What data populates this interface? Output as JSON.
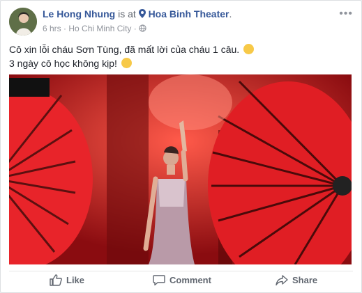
{
  "post": {
    "author": "Le Hong Nhung",
    "is_at": "is at",
    "location": "Hoa Binh Theater",
    "location_suffix": ".",
    "time": "6 hrs",
    "separator": "·",
    "city": "Ho Chi Minh City",
    "separator2": "·",
    "text_line1": "Cô xin lỗi cháu Sơn Tùng, đã mất lời của cháu 1 câu.",
    "text_line2": "3 ngày cô học không kịp!",
    "icons": {
      "pin": "location-pin-icon",
      "globe": "globe-icon",
      "emoji1": "disappointed-face-icon",
      "emoji2": "sad-face-icon"
    }
  },
  "actions": {
    "like": "Like",
    "comment": "Comment",
    "share": "Share"
  },
  "colors": {
    "link": "#365899",
    "stage_red": "#c0141a"
  }
}
